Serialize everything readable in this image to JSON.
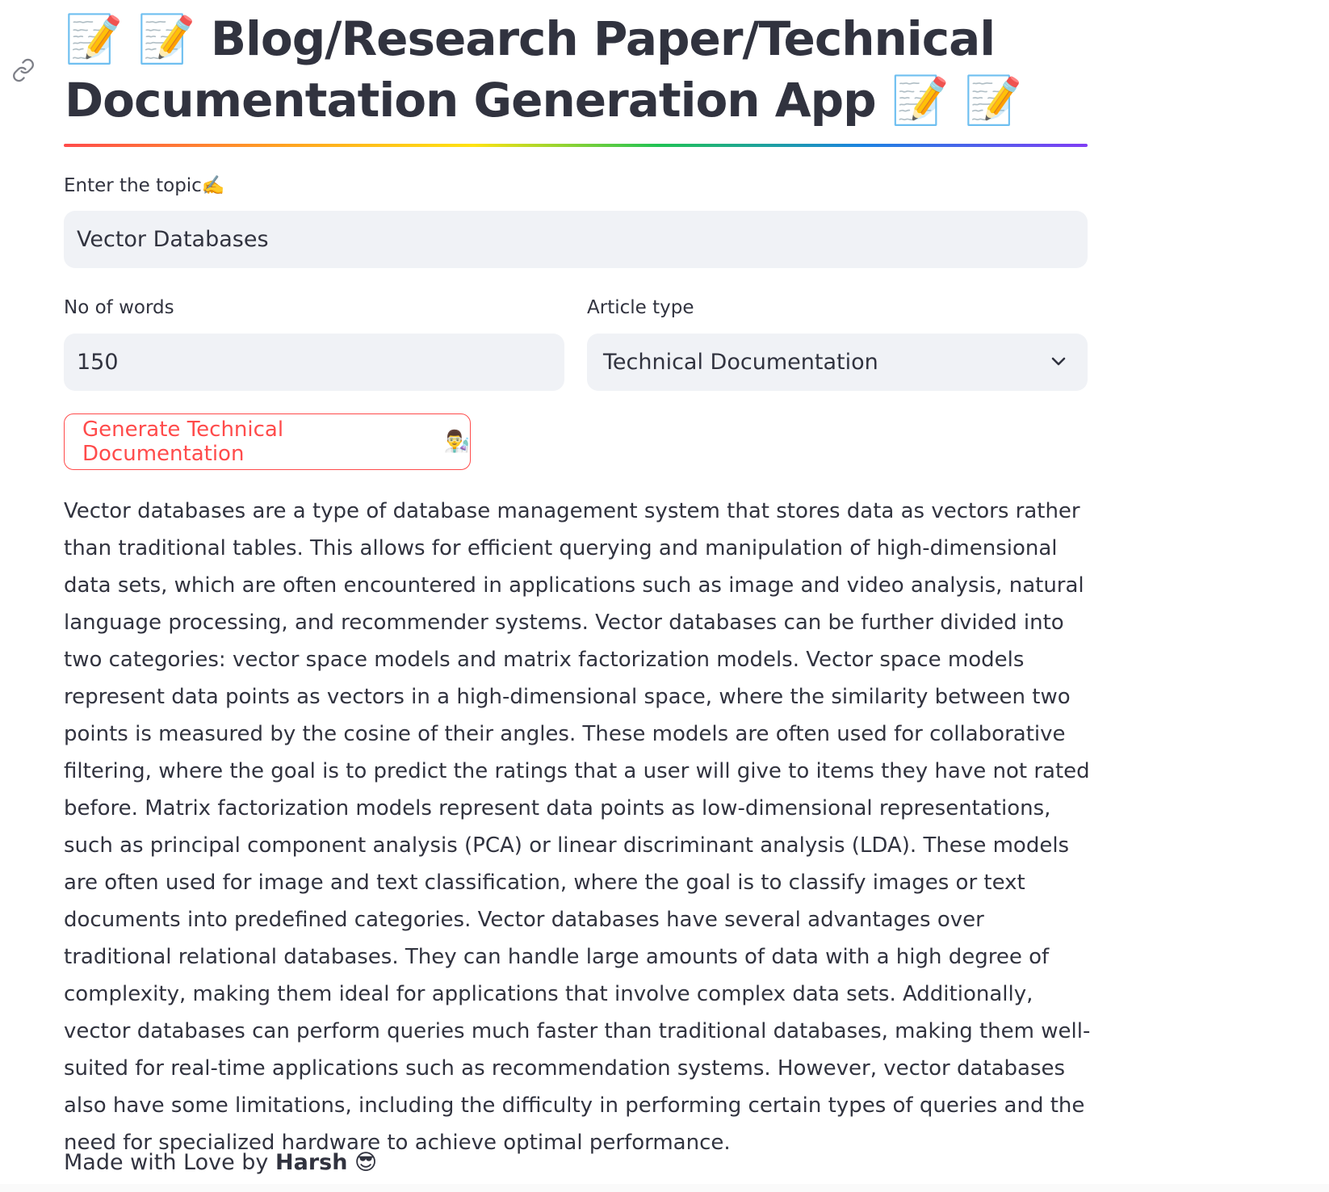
{
  "header": {
    "title": "📝 📝 Blog/Research Paper/Technical Documentation Generation App 📝 📝"
  },
  "topic": {
    "label": "Enter the topic✍️",
    "value": "Vector Databases"
  },
  "words": {
    "label": "No of words",
    "value": "150"
  },
  "article_type": {
    "label": "Article type",
    "selected": "Technical Documentation"
  },
  "generate_button": {
    "label": "Generate Technical Documentation",
    "emoji": "👨‍🔬"
  },
  "result": {
    "text": "Vector databases are a type of database management system that stores data as vectors rather than traditional tables. This allows for efficient querying and manipulation of high-dimensional data sets, which are often encountered in applications such as image and video analysis, natural language processing, and recommender systems. Vector databases can be further divided into two categories: vector space models and matrix factorization models. Vector space models represent data points as vectors in a high-dimensional space, where the similarity between two points is measured by the cosine of their angles. These models are often used for collaborative filtering, where the goal is to predict the ratings that a user will give to items they have not rated before. Matrix factorization models represent data points as low-dimensional representations, such as principal component analysis (PCA) or linear discriminant analysis (LDA). These models are often used for image and text classification, where the goal is to classify images or text documents into predefined categories. Vector databases have several advantages over traditional relational databases. They can handle large amounts of data with a high degree of complexity, making them ideal for applications that involve complex data sets. Additionally, vector databases can perform queries much faster than traditional databases, making them well-suited for real-time applications such as recommendation systems. However, vector databases also have some limitations, including the difficulty in performing certain types of queries and the need for specialized hardware to achieve optimal performance."
  },
  "footer": {
    "prefix": "Made with Love by ",
    "author": "Harsh",
    "emoji": "😎"
  },
  "icons": {
    "anchor": "link-icon",
    "select": "chevron-down-icon"
  },
  "colors": {
    "primary": "#ff4b4b",
    "text": "#31333f",
    "input_bg": "#f0f2f6"
  }
}
